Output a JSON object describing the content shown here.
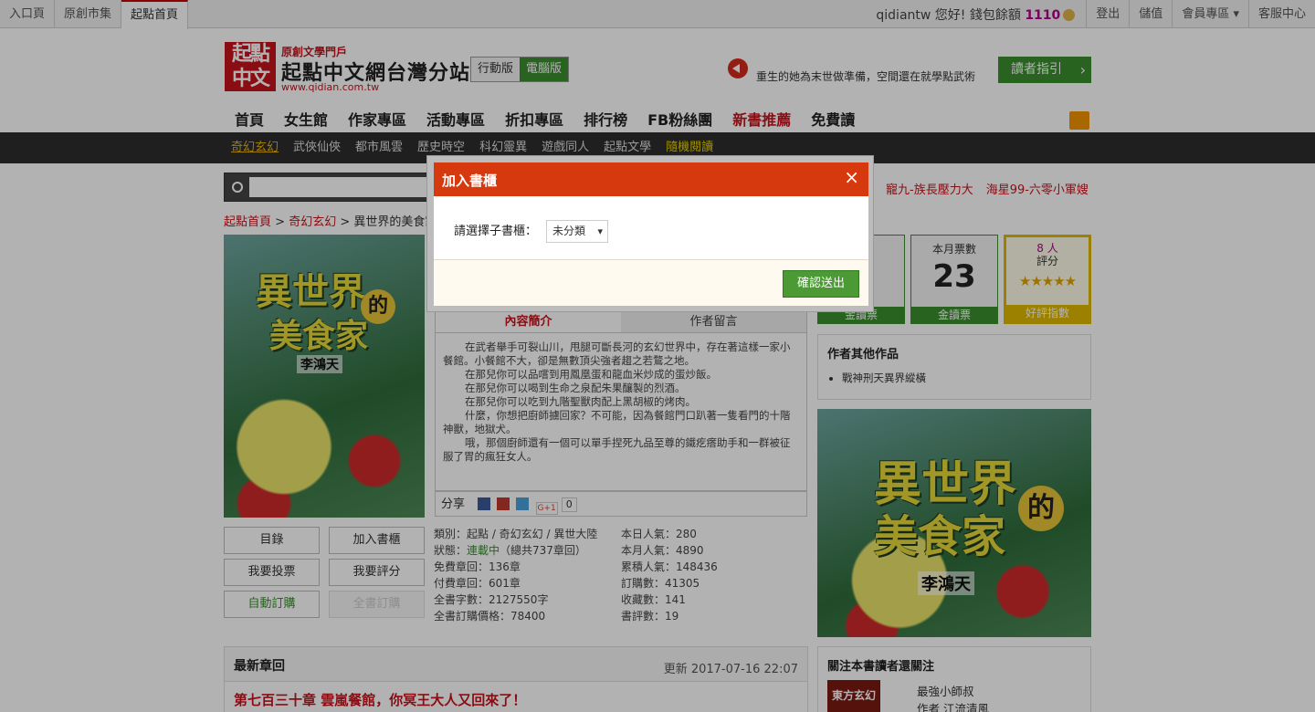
{
  "topbar": {
    "tabs": [
      "入口頁",
      "原創市集",
      "起點首頁"
    ],
    "user": "qidiantw",
    "greeting": "您好! 錢包餘額",
    "balance": "1110",
    "links": [
      "登出",
      "儲值",
      "會員專區 ▾",
      "客服中心"
    ]
  },
  "header": {
    "logo_text": "起點中文",
    "subtitle": "原創文學門戶",
    "title": "起點中文網台灣分站",
    "url": "www.qidian.com.tw",
    "version_mobile": "行動版",
    "version_pc": "電腦版",
    "announcement": "重生的她為末世做準備，空間還在就學點武術",
    "guide_button": "讀者指引"
  },
  "nav": [
    "首頁",
    "女生館",
    "作家專區",
    "活動專區",
    "折扣專區",
    "排行榜",
    "FB粉絲團",
    "新書推薦",
    "免費讀"
  ],
  "subnav": [
    "奇幻玄幻",
    "武俠仙俠",
    "都市風雲",
    "歷史時空",
    "科幻靈異",
    "遊戲同人",
    "起點文學",
    "隨機閱讀"
  ],
  "hot_links": [
    "寵九-族長壓力大",
    "海星99-六零小軍嫂"
  ],
  "breadcrumb": {
    "home": "起點首頁",
    "sep": ">",
    "cat": "奇幻玄幻",
    "book": "異世界的美食家"
  },
  "cover": {
    "title_line1": "異世界",
    "de": "的",
    "title_line2": "美食家",
    "author": "李鴻天"
  },
  "book_buttons": {
    "catalog": "目錄",
    "add_shelf": "加入書櫃",
    "vote": "我要投票",
    "rate": "我要評分",
    "auto_sub": "自動訂購",
    "full_sub": "全書訂購"
  },
  "tabs": {
    "intro": "內容簡介",
    "author_msg": "作者留言"
  },
  "intro_paragraphs": [
    "在武者舉手可裂山川，甩腿可斷長河的玄幻世界中，存在著這樣一家小餐館。小餐館不大，卻是無數頂尖強者趨之若鶩之地。",
    "在那兒你可以品嚐到用鳳凰蛋和龍血米炒成的蛋炒飯。",
    "在那兒你可以喝到生命之泉配朱果釀製的烈酒。",
    "在那兒你可以吃到九階聖獸肉配上黑胡椒的烤肉。",
    "什麼，你想把廚師擄回家？不可能，因為餐館門口趴著一隻看門的十階神獸，地獄犬。",
    "哦，那個廚師還有一個可以單手捏死九品至尊的鐵疙瘩助手和一群被征服了胃的瘋狂女人。"
  ],
  "share": {
    "label": "分享",
    "count": "0"
  },
  "meta_left": {
    "type": "類別：起點 / 奇幻玄幻 / 異世大陸",
    "status_prefix": "狀態：",
    "status": "連載中",
    "status_suffix": "（總共737章回）",
    "free": "免費章回：136章",
    "paid": "付費章回：601章",
    "words": "全書字數：2127550字",
    "price": "全書訂購價格：78400"
  },
  "meta_right": {
    "today": "本日人氣：280",
    "month": "本月人氣：4890",
    "total": "累積人氣：148436",
    "subs": "訂購數：41305",
    "collect": "收藏數：141",
    "reviews": "書評數：19"
  },
  "stats": {
    "gold_label": "金讀票",
    "month_label": "本月票數",
    "month_value": "23",
    "month_foot": "金讀票",
    "rate_people": "8 人",
    "rate_label": "評分",
    "rate_foot": "好評指數",
    "rating_stars": 5
  },
  "other_works": {
    "title": "作者其他作品",
    "items": [
      "戰神刑天異界縱橫"
    ]
  },
  "latest": {
    "title": "最新章回",
    "updated": "更新 2017-07-16 22:07",
    "chapter": "第七百三十章 雲嵐餐館，你冥王大人又回來了！"
  },
  "fans": {
    "title": "關注本書讀者還關注",
    "thumb": "東方玄幻",
    "name": "最強小師叔",
    "author": "作者 江流清風"
  },
  "modal": {
    "title": "加入書櫃",
    "close": "×",
    "label": "請選擇子書櫃：",
    "select_value": "未分類",
    "submit": "確認送出"
  },
  "colors": {
    "brand_red": "#c8141e",
    "green": "#3a8e2f",
    "modal_header": "#d6390e",
    "gold": "#e0b800"
  }
}
